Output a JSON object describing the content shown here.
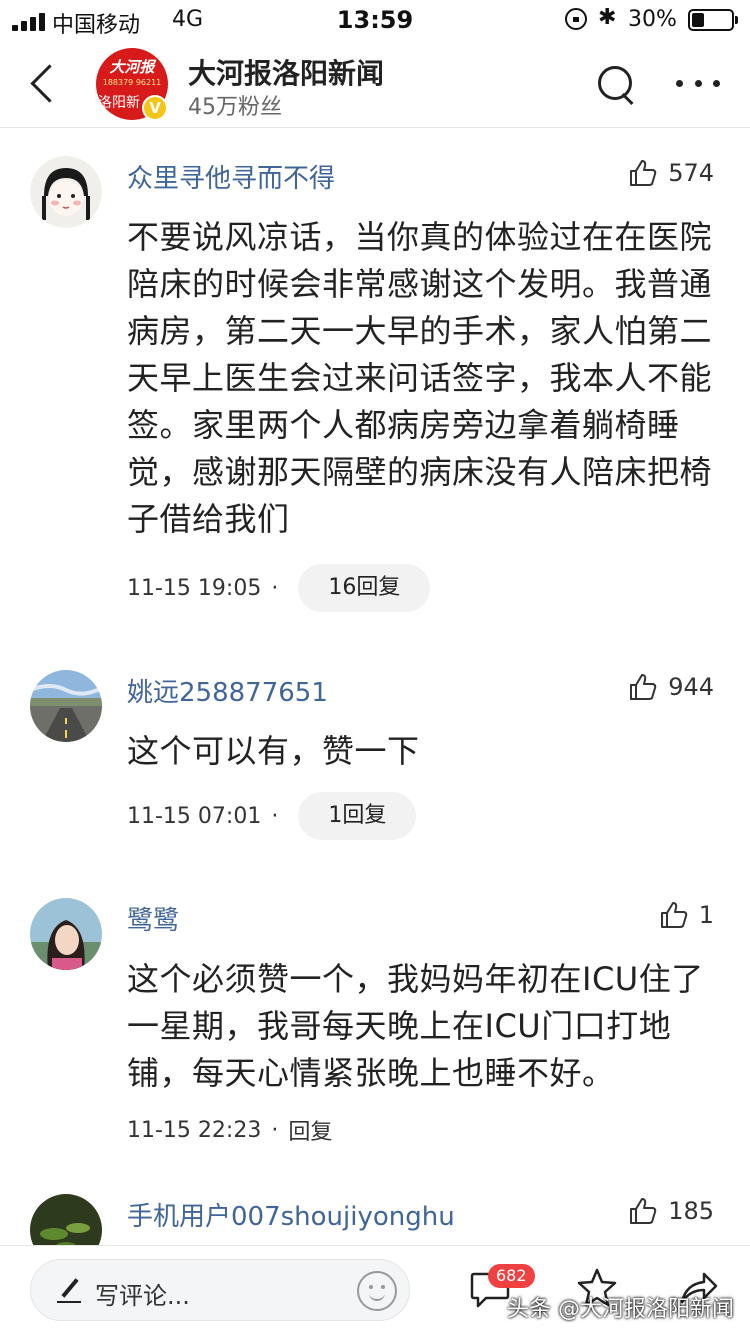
{
  "status_bar": {
    "carrier": "中国移动",
    "network": "4G",
    "time": "13:59",
    "battery_pct": "30%",
    "bluetooth": "✱"
  },
  "header": {
    "channel_name": "大河报洛阳新闻",
    "fans": "45万粉丝",
    "avatar_line1": "大河报",
    "avatar_line2": "188379 96211",
    "avatar_line3": "洛阳新",
    "verified_badge": "V"
  },
  "comments": [
    {
      "name": "众里寻他寻而不得",
      "likes": "574",
      "text": "不要说风凉话，当你真的体验过在在医院陪床的时候会非常感谢这个发明。我普通病房，第二天一大早的手术，家人怕第二天早上医生会过来问话签字，我本人不能签。家里两个人都病房旁边拿着躺椅睡觉，感谢那天隔壁的病床没有人陪床把椅子借给我们",
      "time": "11-15 19:05",
      "dot": "·",
      "reply": "16回复"
    },
    {
      "name": "姚远258877651",
      "likes": "944",
      "text": "这个可以有，赞一下",
      "time": "11-15 07:01",
      "dot": "·",
      "reply": "1回复"
    },
    {
      "name": "鹭鹭",
      "likes": "1",
      "text": "这个必须赞一个，我妈妈年初在ICU住了一星期，我哥每天晚上在ICU门口打地铺，每天心情紧张晚上也睡不好。",
      "time": "11-15 22:23",
      "dot": "·",
      "reply": "回复"
    },
    {
      "name": "手机用户007shoujiyonghu",
      "likes": "185"
    }
  ],
  "bottom_bar": {
    "input_placeholder": "写评论...",
    "comment_count": "682",
    "watermark": "头条 @大河报洛阳新闻"
  },
  "icons": {
    "back": "back-arrow-icon",
    "search": "search-icon",
    "more": "more-icon",
    "like": "thumbs-up-icon",
    "pencil": "pencil-icon",
    "emoji": "emoji-icon",
    "comment": "comment-bubble-icon",
    "star": "star-icon",
    "share": "share-icon"
  },
  "colors": {
    "username": "#406599",
    "badge": "#f04142",
    "verified": "#f5c518",
    "channel_avatar": "#d71b1b"
  }
}
